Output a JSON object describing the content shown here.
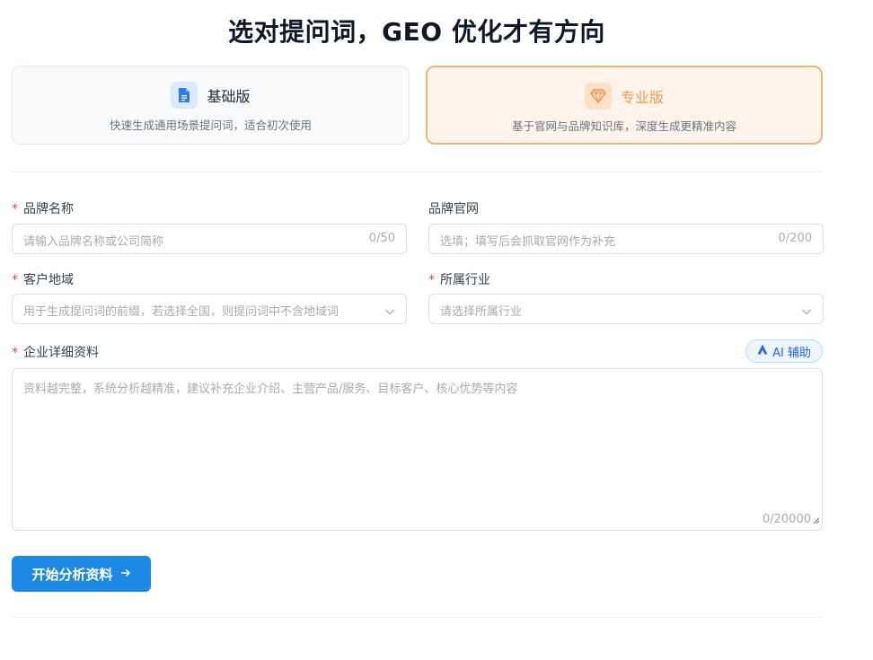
{
  "title": "选对提问词，GEO 优化才有方向",
  "plans": {
    "basic": {
      "name": "基础版",
      "description": "快速生成通用场景提问词，适合初次使用",
      "icon": "document-icon"
    },
    "pro": {
      "name": "专业版",
      "description": "基于官网与品牌知识库，深度生成更精准内容",
      "icon": "diamond-icon",
      "selected": true
    }
  },
  "form": {
    "required_mark": "*",
    "brand_name": {
      "label": "品牌名称",
      "required": true,
      "placeholder": "请输入品牌名称或公司简称",
      "count": "0/50"
    },
    "brand_website": {
      "label": "品牌官网",
      "required": false,
      "placeholder": "选填；填写后会抓取官网作为补充",
      "count": "0/200"
    },
    "customer_region": {
      "label": "客户地域",
      "required": true,
      "placeholder": "用于生成提问词的前缀，若选择全国，则提问词中不含地域词"
    },
    "industry": {
      "label": "所属行业",
      "required": true,
      "placeholder": "请选择所属行业"
    },
    "company_details": {
      "label": "企业详细资料",
      "required": true,
      "placeholder": "资料越完整，系统分析越精准，建议补充企业介绍、主营产品/服务、目标客户、核心优势等内容",
      "count": "0/20000"
    },
    "ai_assist_label": "AI 辅助",
    "submit_label": "开始分析资料"
  },
  "colors": {
    "accent": "#1e88e5",
    "pro_orange": "#ee9b54",
    "required_red": "#ef4444"
  }
}
